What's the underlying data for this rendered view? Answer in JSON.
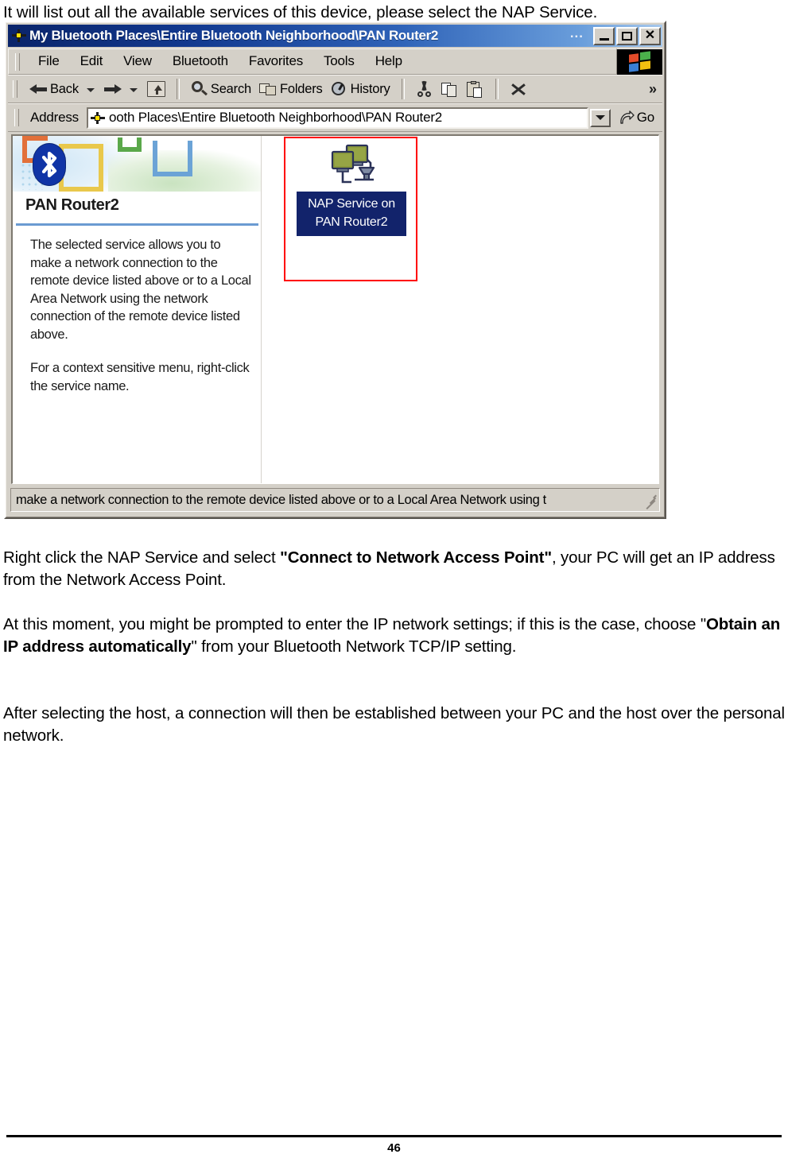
{
  "doc": {
    "intro": "It will list out all the available services of this device, please select the NAP Service.",
    "para1_pre": "Right click the NAP Service and select ",
    "para1_bold": "\"Connect to Network Access Point\"",
    "para1_post": ", your PC will get an IP address from the Network Access Point.",
    "para2_pre": "At this moment, you might be prompted to enter the IP network settings; if this is the case, choose \"",
    "para2_bold": "Obtain an IP address automatically",
    "para2_post": "\" from your Bluetooth Network TCP/IP setting.",
    "para3": "After selecting the host, a connection will then be established between your PC and the host over the personal network.",
    "page_number": "46"
  },
  "window": {
    "title": "My Bluetooth Places\\Entire Bluetooth Neighborhood\\PAN Router2",
    "title_ellipsis": "...",
    "caption_buttons": {
      "minimize": "minimize-button",
      "maximize": "maximize-button",
      "close": "✕"
    },
    "menu": {
      "items": [
        {
          "label": "File"
        },
        {
          "label": "Edit"
        },
        {
          "label": "View"
        },
        {
          "label": "Bluetooth"
        },
        {
          "label": "Favorites"
        },
        {
          "label": "Tools"
        },
        {
          "label": "Help"
        }
      ]
    },
    "toolbar": {
      "back_label": "Back",
      "search_label": "Search",
      "folders_label": "Folders",
      "history_label": "History",
      "overflow_label": "»"
    },
    "address": {
      "label": "Address",
      "value": "ooth Places\\Entire Bluetooth Neighborhood\\PAN Router2",
      "go_label": "Go"
    },
    "info_panel": {
      "device_name": "PAN Router2",
      "description_1": "The selected service allows you to make a network connection to the remote device listed above or to a Local Area Network using the network connection of the remote device listed above.",
      "description_2": "For a context sensitive menu, right-click the service name."
    },
    "items": [
      {
        "label": "NAP Service on PAN Router2",
        "selected": true
      }
    ],
    "status_text": "make a network connection to the remote device listed above or to a Local Area Network using t"
  },
  "colors": {
    "title_bar_start": "#0a246a",
    "title_bar_end": "#a8c9ec",
    "window_face": "#d4d0c8",
    "selection_navy": "#12236b",
    "highlight_red": "#ff0000",
    "panel_rule_blue": "#6b9bd2",
    "bluetooth_blue": "#1034a6"
  }
}
